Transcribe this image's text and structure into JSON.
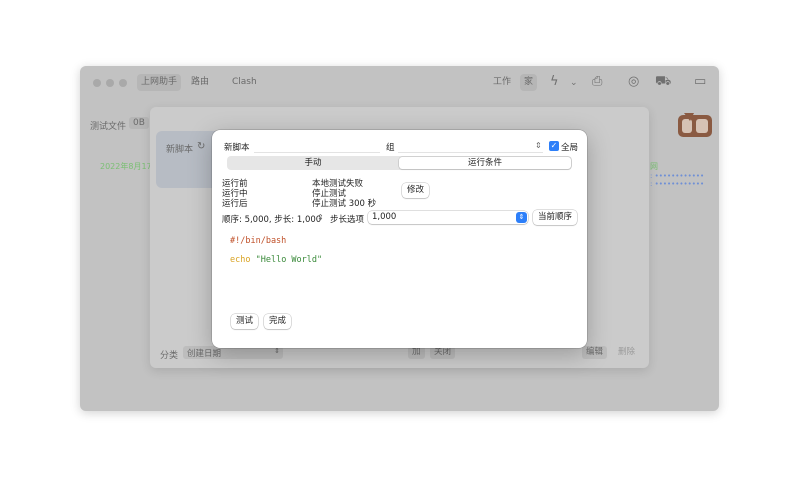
{
  "toolbar": {
    "tabs": [
      "上网助手",
      "路由",
      "Clash"
    ],
    "work_label": "工作",
    "home_label": "家"
  },
  "background": {
    "test_file_label": "测试文件",
    "size_value": "0B",
    "card_title": "新脚本",
    "date_text": "2022年8月17日",
    "right_text": "网",
    "category_label": "分类",
    "sort_value": "创建日期",
    "add_button": "加",
    "close_button": "关闭",
    "edit_button": "编辑",
    "delete_button": "删除"
  },
  "dialog": {
    "name_label": "新脚本",
    "group_label": "组",
    "global_label": "全局",
    "global_checked": true,
    "tabs": [
      "手动",
      "运行条件"
    ],
    "selected_tab": 1,
    "conditions": [
      {
        "label": "运行前",
        "value": "本地测试失败"
      },
      {
        "label": "运行中",
        "value": "停止测试"
      },
      {
        "label": "运行后",
        "value": "停止测试 300 秒"
      }
    ],
    "modify_button": "修改",
    "order_text": "顺序: 5,000, 步长: 1,000",
    "step_label": "步长选项",
    "step_value": "1,000",
    "current_order_button": "当前顺序",
    "code": {
      "shebang": "#!/bin/bash",
      "cmd": "echo",
      "arg": "\"Hello World\""
    },
    "test_button": "测试",
    "done_button": "完成"
  },
  "colors": {
    "accent": "#2d7ff9",
    "shebang": "#c0512a",
    "keyword": "#d9a323",
    "string": "#3a8a3a",
    "green_text": "#7bbf74",
    "blue_text": "#6e8fd6"
  }
}
